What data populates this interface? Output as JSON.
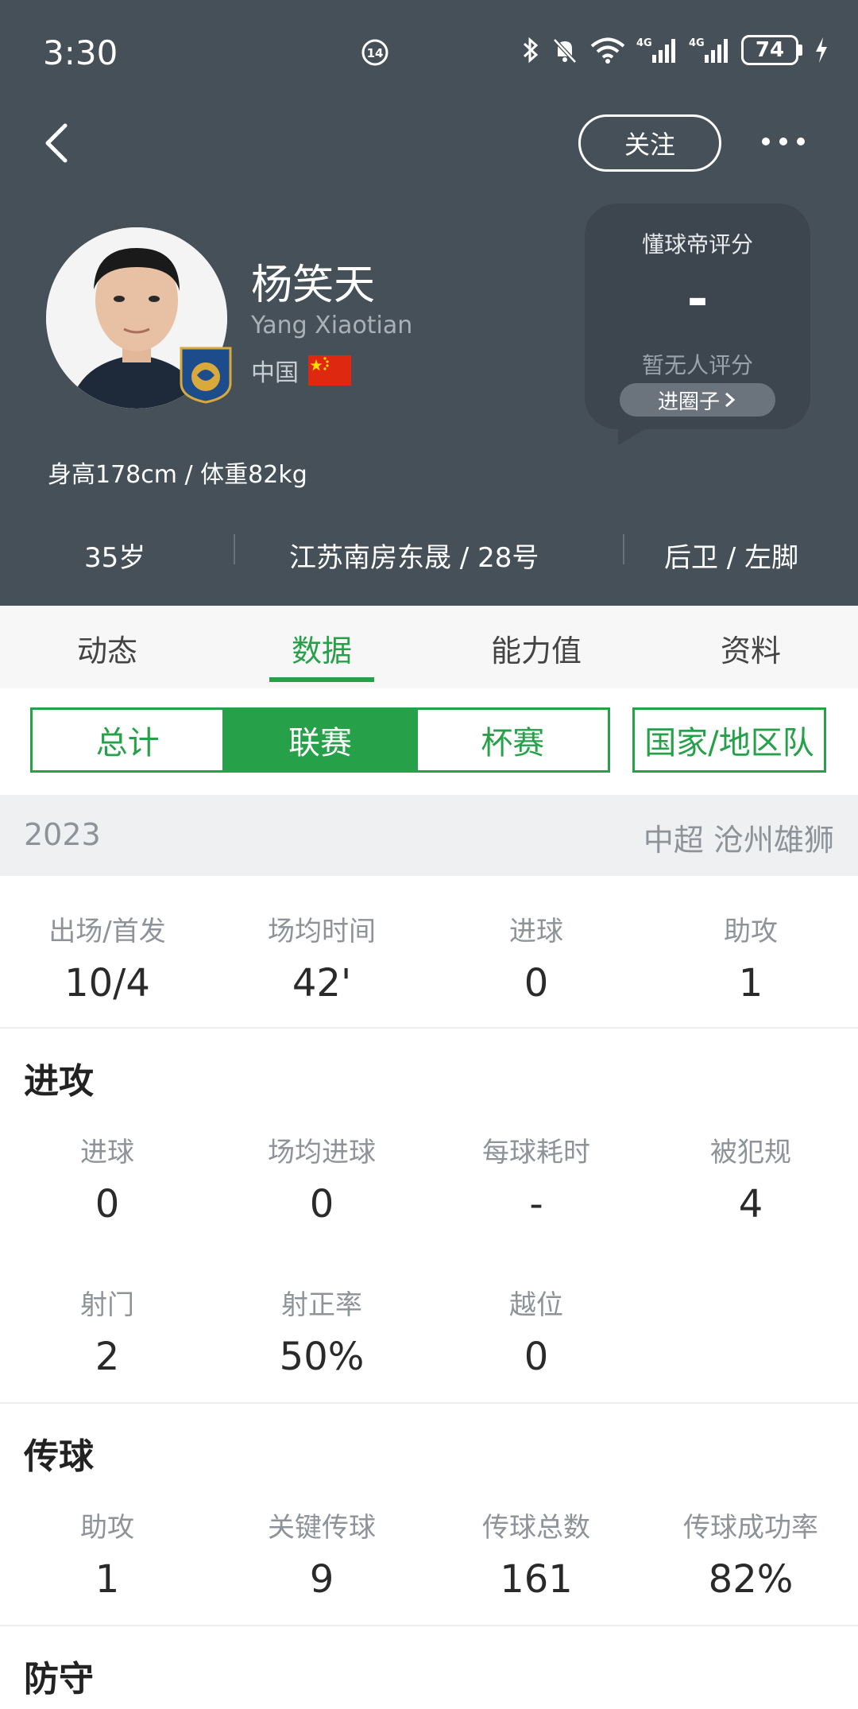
{
  "status_bar": {
    "time": "3:30",
    "battery": "74"
  },
  "header": {
    "follow_label": "关注",
    "player": {
      "name_cn": "杨笑天",
      "name_en": "Yang Xiaotian",
      "nationality": "中国",
      "body_info": "身高178cm / 体重82kg",
      "age": "35岁",
      "club_number": "江苏南房东晟 / 28号",
      "position_foot": "后卫 / 左脚"
    },
    "rating": {
      "title": "懂球帝评分",
      "value": "-",
      "none_text": "暂无人评分",
      "link_label": "进圈子"
    }
  },
  "tabs": [
    {
      "label": "动态"
    },
    {
      "label": "数据",
      "active": true
    },
    {
      "label": "能力值"
    },
    {
      "label": "资料"
    }
  ],
  "segments": [
    {
      "label": "总计"
    },
    {
      "label": "联赛",
      "active": true
    },
    {
      "label": "杯赛"
    }
  ],
  "national_team_label": "国家/地区队",
  "season": {
    "year": "2023",
    "league_team": "中超 沧州雄狮"
  },
  "summary": [
    {
      "label": "出场/首发",
      "value": "10/4"
    },
    {
      "label": "场均时间",
      "value": "42'"
    },
    {
      "label": "进球",
      "value": "0"
    },
    {
      "label": "助攻",
      "value": "1"
    }
  ],
  "attack": {
    "title": "进攻",
    "row1": [
      {
        "label": "进球",
        "value": "0"
      },
      {
        "label": "场均进球",
        "value": "0"
      },
      {
        "label": "每球耗时",
        "value": "-"
      },
      {
        "label": "被犯规",
        "value": "4"
      }
    ],
    "row2": [
      {
        "label": "射门",
        "value": "2"
      },
      {
        "label": "射正率",
        "value": "50%"
      },
      {
        "label": "越位",
        "value": "0"
      }
    ]
  },
  "passing": {
    "title": "传球",
    "row1": [
      {
        "label": "助攻",
        "value": "1"
      },
      {
        "label": "关键传球",
        "value": "9"
      },
      {
        "label": "传球总数",
        "value": "161"
      },
      {
        "label": "传球成功率",
        "value": "82%"
      }
    ]
  },
  "defense": {
    "title": "防守"
  },
  "colors": {
    "header_bg": "#465059",
    "accent_green": "#27a04a"
  }
}
